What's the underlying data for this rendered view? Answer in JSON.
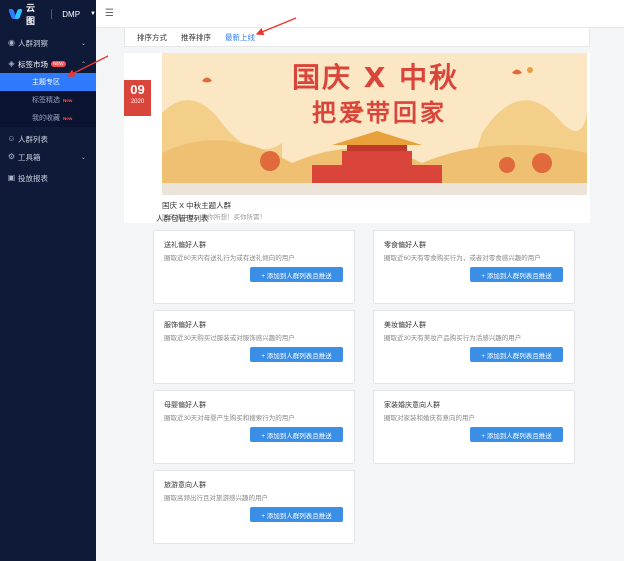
{
  "app": {
    "brand": "云图",
    "product": "DMP"
  },
  "sidebar": {
    "items": [
      {
        "label": "人群洞察",
        "icon": "eye-icon"
      },
      {
        "label": "标签市场",
        "icon": "tag-icon",
        "badge": "NEW"
      },
      {
        "label": "主题专区",
        "active": true
      },
      {
        "label": "标签精选",
        "badge": "New"
      },
      {
        "label": "我的收藏",
        "badge": "New"
      },
      {
        "label": "人群列表",
        "icon": "user-icon"
      },
      {
        "label": "工具箱",
        "icon": "toolbox-icon"
      },
      {
        "label": "投放报表",
        "icon": "report-icon"
      }
    ]
  },
  "tabs": [
    "排序方式",
    "推荐排序",
    "最新上线"
  ],
  "banner": {
    "day": "09",
    "year": "2020",
    "headline1": "国庆 X 中秋",
    "headline2": "把爱带回家",
    "title": "国庆 X 中秋主题人群",
    "subtitle": "国庆撞中秋，去你所想！买你所需！"
  },
  "section_title": "人群包管理列表",
  "cards": [
    {
      "title": "送礼偏好人群",
      "desc": "圈取近60天内有送礼行为或有送礼倾向的用户",
      "button": "+ 添加到人群列表且推送"
    },
    {
      "title": "零食偏好人群",
      "desc": "圈取近60天有零食购买行为，或者对零食感兴趣的用户",
      "button": "+ 添加到人群列表且推送"
    },
    {
      "title": "服饰偏好人群",
      "desc": "圈取近30天购买过服装或对服饰感兴趣的用户",
      "button": "+ 添加到人群列表且推送"
    },
    {
      "title": "美妆偏好人群",
      "desc": "圈取近30天有美妆产品购买行为活感兴趣的用户",
      "button": "+ 添加到人群列表且推送"
    },
    {
      "title": "母婴偏好人群",
      "desc": "圈取近30天对母婴产生购买和搜索行为的用户",
      "button": "+ 添加到人群列表且推送"
    },
    {
      "title": "家装婚庆意向人群",
      "desc": "圈取对家装和婚庆有意向的用户",
      "button": "+ 添加到人群列表且推送"
    },
    {
      "title": "旅游意向人群",
      "desc": "圈取高频出行且对旅游感兴趣的用户",
      "button": "+ 添加到人群列表且推送"
    }
  ],
  "colors": {
    "sidebar": "#0f1a38",
    "accent": "#2f7bff",
    "button": "#3a8ee6",
    "festive_red": "#d9453b"
  }
}
